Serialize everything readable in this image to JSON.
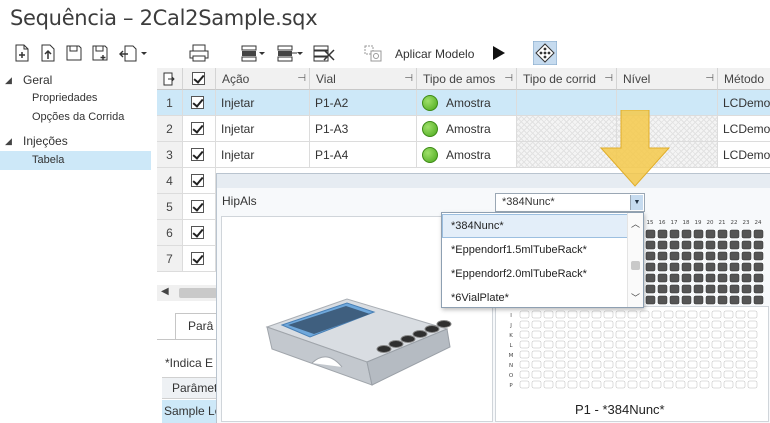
{
  "window": {
    "title": "Sequência – 2Cal2Sample.sqx"
  },
  "toolbar": {
    "apply_model_label": "Aplicar Modelo",
    "icons": [
      "new-row-icon",
      "import-icon",
      "save-icon",
      "save-as-icon",
      "export-icon",
      "print-icon",
      "fill-down-icon",
      "fill-options-icon",
      "delete-rows-icon",
      "apply-model-icon",
      "play-icon",
      "plate-view-icon"
    ]
  },
  "sidebar": {
    "groups": [
      {
        "label": "Geral",
        "items": [
          "Propriedades",
          "Opções da Corrida"
        ]
      },
      {
        "label": "Injeções",
        "items": [
          "Tabela"
        ]
      }
    ]
  },
  "table": {
    "columns": [
      "Ação",
      "Vial",
      "Tipo de amos",
      "Tipo de corrid",
      "Nível",
      "Método"
    ],
    "rows": [
      {
        "num": "1",
        "acao": "Injetar",
        "vial": "P1-A2",
        "tipo": "Amostra",
        "metodo": "LCDemo.a"
      },
      {
        "num": "2",
        "acao": "Injetar",
        "vial": "P1-A3",
        "tipo": "Amostra",
        "metodo": "LCDemo.a"
      },
      {
        "num": "3",
        "acao": "Injetar",
        "vial": "P1-A4",
        "tipo": "Amostra",
        "metodo": "LCDemo.a"
      },
      {
        "num": "4"
      },
      {
        "num": "5"
      },
      {
        "num": "6"
      },
      {
        "num": "7"
      }
    ]
  },
  "bottom_panel": {
    "tab_label": "Parâ",
    "note": "*Indica E",
    "column_header": "Parâmet",
    "row_label": "Sample Lo"
  },
  "plate_viewer": {
    "module_label": "HipAls",
    "selected_rack": "*384Nunc*",
    "rack_options": [
      "*384Nunc*",
      "*Eppendorf1.5mlTubeRack*",
      "*Eppendorf2.0mlTubeRack*",
      "*6VialPlate*"
    ],
    "plate_caption": "P1 - *384Nunc*",
    "plate_col_labels": [
      "15",
      "16",
      "17",
      "18",
      "19",
      "20",
      "21",
      "22",
      "23",
      "24"
    ],
    "plate_row_labels": [
      "I",
      "J",
      "K",
      "L",
      "M",
      "N",
      "O",
      "P"
    ]
  },
  "colors": {
    "selection": "#cde8f8",
    "sample_dot": "#4aa81c",
    "callout_arrow": "#f5c94a"
  }
}
